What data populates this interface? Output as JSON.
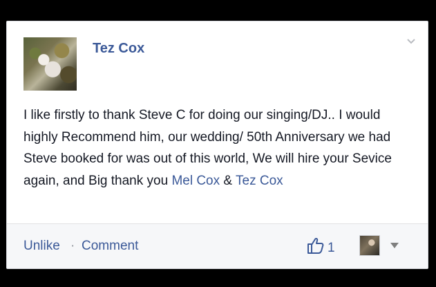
{
  "post": {
    "author": "Tez Cox",
    "body_text": "I like firstly to thank Steve C for doing our singing/DJ.. I would highly Recommend him, our wedding/ 50th Anniversary we had Steve booked for was out of this world, We will hire your Sevice again, and Big thank you ",
    "mention_1": "Mel Cox",
    "amp": " & ",
    "mention_2": "Tez Cox",
    "avatar_icon": "profile-photo",
    "menu_icon": "chevron-down-icon"
  },
  "footer": {
    "unlike": "Unlike",
    "separator": "·",
    "comment": "Comment",
    "like_count": "1",
    "like_icon": "thumbs-up-icon",
    "mini_avatar": "commenter-avatar",
    "caret_icon": "caret-down-icon"
  },
  "colors": {
    "link": "#3b5998",
    "text": "#141823",
    "footer_bg": "#f6f7f9"
  }
}
